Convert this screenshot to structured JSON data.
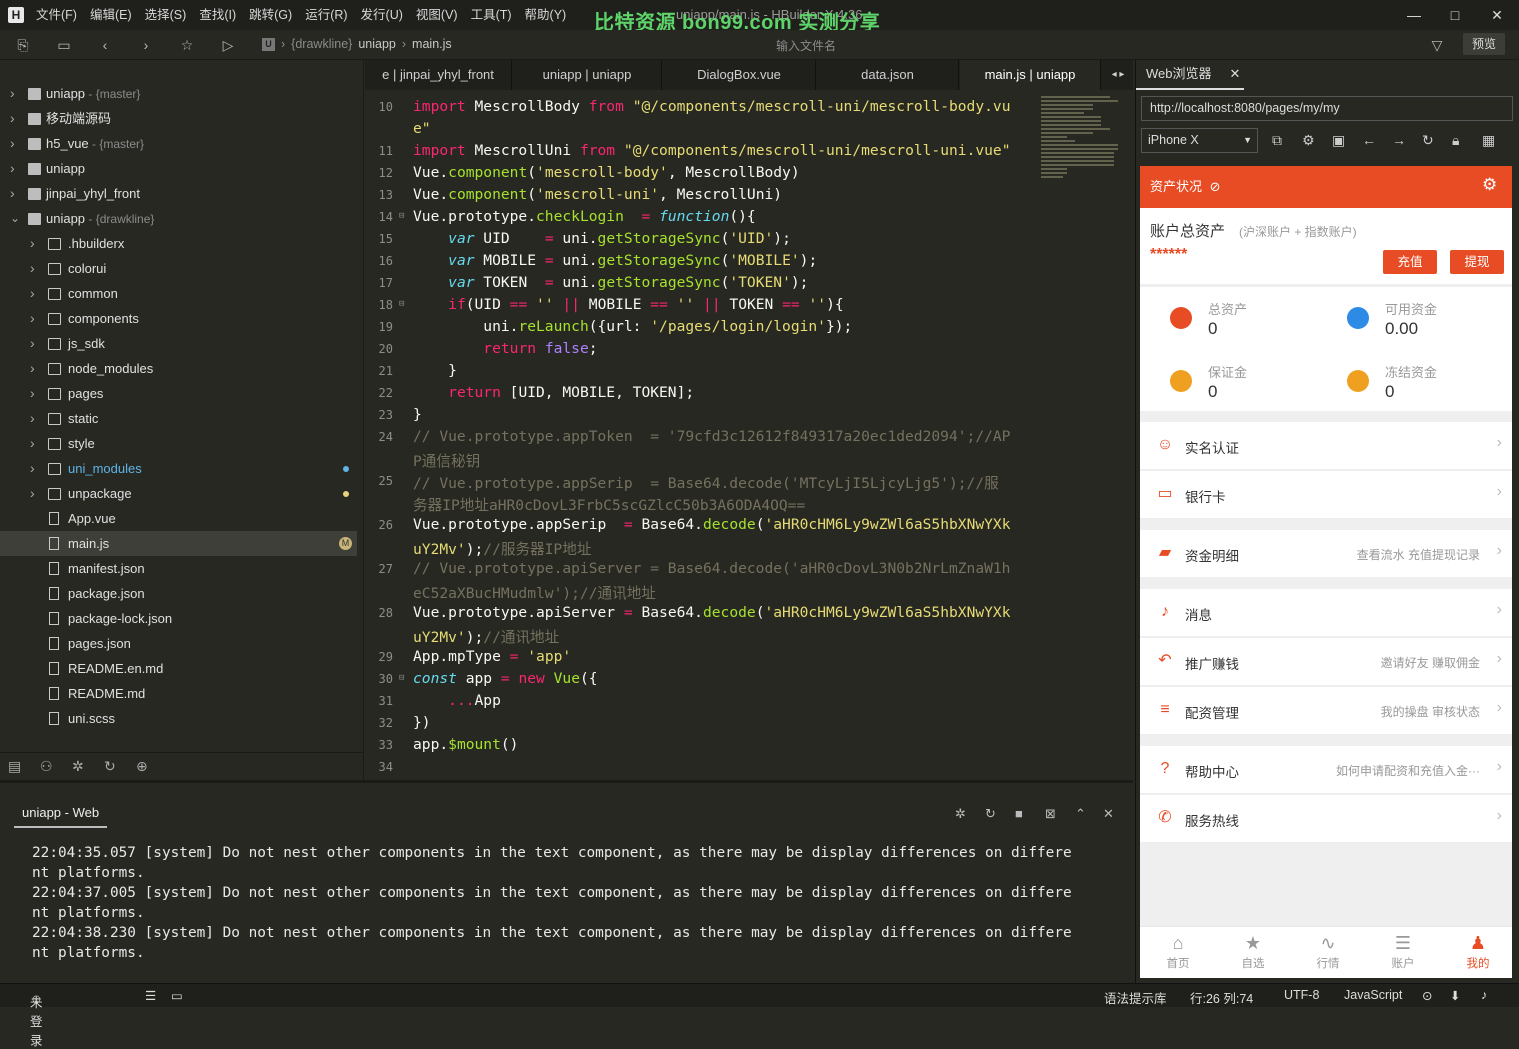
{
  "titlebar": {
    "menu": [
      "文件(F)",
      "编辑(E)",
      "选择(S)",
      "查找(I)",
      "跳转(G)",
      "运行(R)",
      "发行(U)",
      "视图(V)",
      "工具(T)",
      "帮助(Y)"
    ],
    "title": "uniapp/main.js - HBuilder X 4.36",
    "watermark": "比特资源 bon99.com 实测分享",
    "controls": [
      "—",
      "□",
      "✕"
    ]
  },
  "toolbar": {
    "breadcrumb": {
      "project": "{drawkline}",
      "name": "uniapp",
      "file": "main.js"
    },
    "search_placeholder": "输入文件名",
    "preview_label": "预览"
  },
  "sidebar": {
    "items": [
      {
        "label": "uniapp",
        "branch": " - {master}",
        "depth": 0,
        "type": "proj",
        "open": false
      },
      {
        "label": "移动端源码",
        "branch": "",
        "depth": 0,
        "type": "proj",
        "open": false
      },
      {
        "label": "h5_vue",
        "branch": " - {master}",
        "depth": 0,
        "type": "proj",
        "open": false
      },
      {
        "label": "uniapp",
        "branch": "",
        "depth": 0,
        "type": "proj",
        "open": false
      },
      {
        "label": "jinpai_yhyl_front",
        "branch": "",
        "depth": 0,
        "type": "proj",
        "open": false
      },
      {
        "label": "uniapp",
        "branch": " - {drawkline}",
        "depth": 0,
        "type": "proj",
        "open": true
      },
      {
        "label": ".hbuilderx",
        "depth": 1,
        "type": "folder"
      },
      {
        "label": "colorui",
        "depth": 1,
        "type": "folder"
      },
      {
        "label": "common",
        "depth": 1,
        "type": "folder"
      },
      {
        "label": "components",
        "depth": 1,
        "type": "folder"
      },
      {
        "label": "js_sdk",
        "depth": 1,
        "type": "folder"
      },
      {
        "label": "node_modules",
        "depth": 1,
        "type": "folder"
      },
      {
        "label": "pages",
        "depth": 1,
        "type": "folder"
      },
      {
        "label": "static",
        "depth": 1,
        "type": "folder"
      },
      {
        "label": "style",
        "depth": 1,
        "type": "folder"
      },
      {
        "label": "uni_modules",
        "depth": 1,
        "type": "folder",
        "color": "#5fb3e6",
        "dot": "#5fb3e6"
      },
      {
        "label": "unpackage",
        "depth": 1,
        "type": "folder",
        "dot": "#e6d27a"
      },
      {
        "label": "App.vue",
        "depth": 1,
        "type": "file"
      },
      {
        "label": "main.js",
        "depth": 1,
        "type": "file",
        "selected": true,
        "badge": "M"
      },
      {
        "label": "manifest.json",
        "depth": 1,
        "type": "file"
      },
      {
        "label": "package.json",
        "depth": 1,
        "type": "file"
      },
      {
        "label": "package-lock.json",
        "depth": 1,
        "type": "file"
      },
      {
        "label": "pages.json",
        "depth": 1,
        "type": "file"
      },
      {
        "label": "README.en.md",
        "depth": 1,
        "type": "file"
      },
      {
        "label": "README.md",
        "depth": 1,
        "type": "file"
      },
      {
        "label": "uni.scss",
        "depth": 1,
        "type": "file"
      }
    ]
  },
  "tabs": [
    {
      "label": "e | jinpai_yhyl_front",
      "active": false
    },
    {
      "label": "uniapp | uniapp",
      "active": false
    },
    {
      "label": "DialogBox.vue",
      "active": false
    },
    {
      "label": "data.json",
      "active": false
    },
    {
      "label": "main.js | uniapp",
      "active": true
    }
  ],
  "code": [
    {
      "n": "10",
      "html": "<span class=\"kw\">import</span> MescrollBody <span class=\"kw\">from</span> <span class=\"st\">\"@/components/mescroll-uni/mescroll-body.vu</span>"
    },
    {
      "n": "",
      "html": "<span class=\"st\">e\"</span>"
    },
    {
      "n": "11",
      "html": "<span class=\"kw\">import</span> MescrollUni <span class=\"kw\">from</span> <span class=\"st\">\"@/components/mescroll-uni/mescroll-uni.vue\"</span>"
    },
    {
      "n": "12",
      "html": "Vue.<span class=\"fn\">component</span>(<span class=\"st\">'mescroll-body'</span>, MescrollBody)"
    },
    {
      "n": "13",
      "html": "Vue.<span class=\"fn\">component</span>(<span class=\"st\">'mescroll-uni'</span>, MescrollUni)"
    },
    {
      "n": "14",
      "fold": true,
      "html": "Vue.prototype.<span class=\"fn\">checkLogin</span>  <span class=\"kw\">=</span> <span class=\"bl\">function</span>(){"
    },
    {
      "n": "15",
      "html": "    <span class=\"bl\">var</span> UID    <span class=\"kw\">=</span> uni.<span class=\"fn\">getStorageSync</span>(<span class=\"st\">'UID'</span>);"
    },
    {
      "n": "16",
      "html": "    <span class=\"bl\">var</span> MOBILE <span class=\"kw\">=</span> uni.<span class=\"fn\">getStorageSync</span>(<span class=\"st\">'MOBILE'</span>);"
    },
    {
      "n": "17",
      "html": "    <span class=\"bl\">var</span> TOKEN  <span class=\"kw\">=</span> uni.<span class=\"fn\">getStorageSync</span>(<span class=\"st\">'TOKEN'</span>);"
    },
    {
      "n": "18",
      "fold": true,
      "html": "    <span class=\"kw\">if</span>(UID <span class=\"kw\">==</span> <span class=\"st\">''</span> <span class=\"kw\">||</span> MOBILE <span class=\"kw\">==</span> <span class=\"st\">''</span> <span class=\"kw\">||</span> TOKEN <span class=\"kw\">==</span> <span class=\"st\">''</span>){"
    },
    {
      "n": "19",
      "html": "        uni.<span class=\"fn\">reLaunch</span>({url: <span class=\"st\">'/pages/login/login'</span>});"
    },
    {
      "n": "20",
      "html": "        <span class=\"kw\">return</span> <span class=\"pu\">false</span>;"
    },
    {
      "n": "21",
      "html": "    }"
    },
    {
      "n": "22",
      "html": "    <span class=\"kw\">return</span> [UID, MOBILE, TOKEN];"
    },
    {
      "n": "23",
      "html": "}"
    },
    {
      "n": "24",
      "html": "<span class=\"cm\">// Vue.prototype.appToken  = '79cfd3c12612f849317a20ec1ded2094';//AP</span>"
    },
    {
      "n": "",
      "html": "<span class=\"cm\">P通信秘钥</span>"
    },
    {
      "n": "25",
      "html": "<span class=\"cm\">// Vue.prototype.appSerip  = Base64.decode('MTcyLjI5LjcyLjg5');//服</span>"
    },
    {
      "n": "",
      "html": "<span class=\"cm\">务器IP地址aHR0cDovL3FrbC5scGZlcC50b3A6ODA4OQ==</span>"
    },
    {
      "n": "26",
      "html": "Vue.prototype.appSerip  <span class=\"kw\">=</span> Base64.<span class=\"fn\">decode</span>(<span class=\"st\">'aHR0cHM6Ly9wZWl6aS5hbXNwYXk</span>"
    },
    {
      "n": "",
      "html": "<span class=\"st\">uY2Mv'</span>);<span class=\"cm\">//服务器IP地址</span>"
    },
    {
      "n": "27",
      "html": "<span class=\"cm\">// Vue.prototype.apiServer = Base64.decode('aHR0cDovL3N0b2NrLmZnaW1h</span>"
    },
    {
      "n": "",
      "html": "<span class=\"cm\">eC52aXBucHMudmlw');//通讯地址</span>"
    },
    {
      "n": "28",
      "html": "Vue.prototype.apiServer <span class=\"kw\">=</span> Base64.<span class=\"fn\">decode</span>(<span class=\"st\">'aHR0cHM6Ly9wZWl6aS5hbXNwYXk</span>"
    },
    {
      "n": "",
      "html": "<span class=\"st\">uY2Mv'</span>);<span class=\"cm\">//通讯地址</span>"
    },
    {
      "n": "29",
      "html": "App.mpType <span class=\"kw\">=</span> <span class=\"st\">'app'</span>"
    },
    {
      "n": "30",
      "fold": true,
      "html": "<span class=\"bl\">const</span> app <span class=\"kw\">=</span> <span class=\"kw\">new</span> <span class=\"fn\">Vue</span>({"
    },
    {
      "n": "31",
      "html": "    <span class=\"kw\">...</span>App"
    },
    {
      "n": "32",
      "html": "})"
    },
    {
      "n": "33",
      "html": "app.<span class=\"fn\">$mount</span>()"
    },
    {
      "n": "34",
      "html": ""
    }
  ],
  "console": {
    "tab": "uniapp - Web",
    "lines": [
      "22:04:35.057 [system] Do not nest other components in the text component, as there may be display differences on differe",
      "nt platforms.",
      "22:04:37.005 [system] Do not nest other components in the text component, as there may be display differences on differe",
      "nt platforms.",
      "22:04:38.230 [system] Do not nest other components in the text component, as there may be display differences on differe",
      "nt platforms."
    ]
  },
  "browser": {
    "tab": "Web浏览器",
    "url": "http://localhost:8080/pages/my/my",
    "device": "iPhone X"
  },
  "phone": {
    "header": "资产状况",
    "total_title": "账户总资产",
    "total_sub": "(沪深账户 + 指数账户)",
    "total_value": "******",
    "btn_recharge": "充值",
    "btn_withdraw": "提现",
    "stats": [
      {
        "label": "总资产",
        "value": "0",
        "color": "#e74c24"
      },
      {
        "label": "可用资金",
        "value": "0.00",
        "color": "#2d8be6"
      },
      {
        "label": "保证金",
        "value": "0",
        "color": "#f0a020"
      },
      {
        "label": "冻结资金",
        "value": "0",
        "color": "#f0a020"
      }
    ],
    "rows": [
      {
        "label": "实名认证",
        "right": "",
        "icon": "person-icon",
        "glyph": "☺"
      },
      {
        "label": "银行卡",
        "right": "",
        "icon": "card-icon",
        "glyph": "▭"
      },
      {
        "label": "资金明细",
        "right": "查看流水 充值提现记录",
        "icon": "wallet-icon",
        "glyph": "▰"
      },
      {
        "label": "消息",
        "right": "",
        "icon": "bell-icon",
        "glyph": "♪"
      },
      {
        "label": "推广赚钱",
        "right": "邀请好友 赚取佣金",
        "icon": "share-icon",
        "glyph": "↶"
      },
      {
        "label": "配资管理",
        "right": "我的操盘 审核状态",
        "icon": "sliders-icon",
        "glyph": "≡"
      },
      {
        "label": "帮助中心",
        "right": "如何申请配资和充值入金···",
        "icon": "help-icon",
        "glyph": "?"
      },
      {
        "label": "服务热线",
        "right": "",
        "icon": "phone-icon",
        "glyph": "✆"
      }
    ],
    "nav": [
      {
        "label": "首页",
        "glyph": "⌂"
      },
      {
        "label": "自选",
        "glyph": "★"
      },
      {
        "label": "行情",
        "glyph": "∿"
      },
      {
        "label": "账户",
        "glyph": "☰"
      },
      {
        "label": "我的",
        "glyph": "♟",
        "active": true
      }
    ]
  },
  "status": {
    "login": "未登录",
    "hint_lib": "语法提示库",
    "position": "行:26  列:74",
    "encoding": "UTF-8",
    "language": "JavaScript"
  }
}
